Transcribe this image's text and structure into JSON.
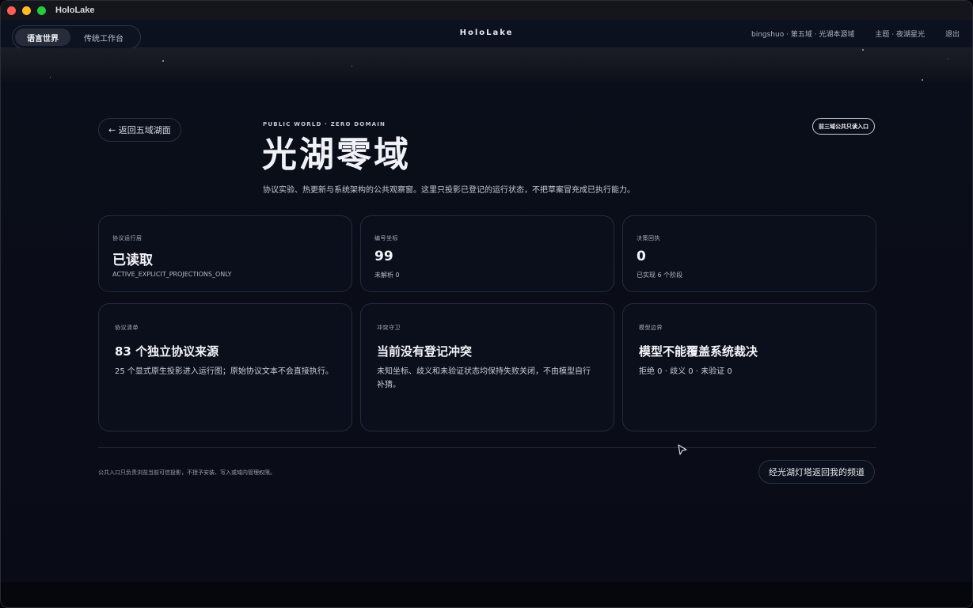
{
  "window": {
    "title": "HoloLake"
  },
  "topnav": {
    "modes": [
      {
        "label": "语言世界",
        "active": true
      },
      {
        "label": "传统工作台",
        "active": false
      }
    ],
    "brand": "HoloLake",
    "user_location": "bingshuo · 第五域 · 光湖本源域",
    "theme": "主题 · 夜湖星光",
    "logout": "退出"
  },
  "header": {
    "back_label": "← 返回五域湖面",
    "eyebrow": "PUBLIC WORLD · ZERO DOMAIN",
    "title": "光湖零域",
    "subtitle": "协议实验、热更新与系统架构的公共观察窗。这里只投影已登记的运行状态，不把草案冒充成已执行能力。",
    "readonly_pill": "前三域公共只读入口"
  },
  "stats": [
    {
      "label": "协议运行层",
      "value": "已读取",
      "note": "ACTIVE_EXPLICIT_PROJECTIONS_ONLY"
    },
    {
      "label": "编号坐标",
      "value": "99",
      "note": "未解析 0"
    },
    {
      "label": "决策回执",
      "value": "0",
      "note": "已实现 6 个阶段"
    }
  ],
  "panels": [
    {
      "label": "协议清单",
      "title": "83 个独立协议来源",
      "desc": "25 个显式原生投影进入运行图；原始协议文本不会直接执行。"
    },
    {
      "label": "冲突守卫",
      "title": "当前没有登记冲突",
      "desc": "未知坐标、歧义和未验证状态均保持失败关闭，不由模型自行补猜。"
    },
    {
      "label": "模型边界",
      "title": "模型不能覆盖系统裁决",
      "desc": "拒绝 0 · 歧义 0 · 未验证 0"
    }
  ],
  "footer": {
    "note": "公共入口只负责浏览当前可信投影，不授予安装、写入或域内管理权限。",
    "return_label": "经光湖灯塔返回我的频道"
  },
  "colors": {
    "background": "#0a0e1a",
    "card_border": "#252b3a",
    "text_primary": "#f1f3f7"
  }
}
